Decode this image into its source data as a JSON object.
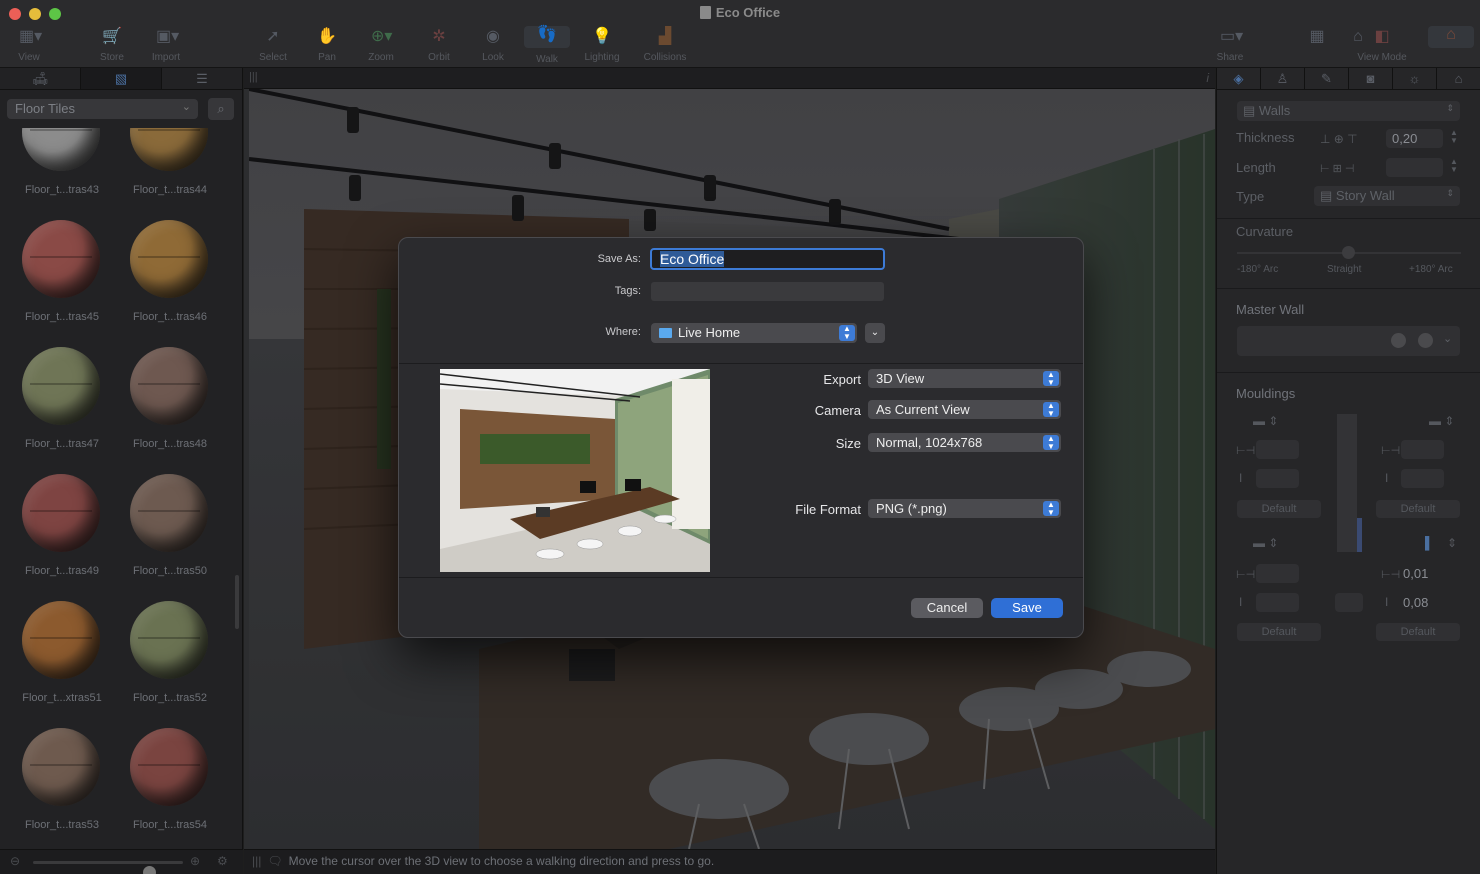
{
  "window": {
    "title": "Eco Office"
  },
  "toolbar": {
    "tools": [
      {
        "label": "View",
        "icon": "view-icon"
      },
      {
        "label": "Store",
        "icon": "cart-icon"
      },
      {
        "label": "Import",
        "icon": "import-icon"
      },
      {
        "label": "Select",
        "icon": "cursor-icon"
      },
      {
        "label": "Pan",
        "icon": "hand-icon"
      },
      {
        "label": "Zoom",
        "icon": "zoom-icon"
      },
      {
        "label": "Orbit",
        "icon": "orbit-icon"
      },
      {
        "label": "Look",
        "icon": "eye-icon"
      },
      {
        "label": "Walk",
        "icon": "walk-icon"
      },
      {
        "label": "Lighting",
        "icon": "bulb-icon"
      },
      {
        "label": "Collisions",
        "icon": "collisions-icon"
      },
      {
        "label": "Share",
        "icon": "share-icon"
      },
      {
        "label": "View Mode",
        "icon": "view-mode-icon"
      }
    ]
  },
  "library": {
    "category": "Floor Tiles",
    "items": [
      {
        "name": "Floor_t...tras43",
        "color": "#8c8c8c"
      },
      {
        "name": "Floor_t...tras44",
        "color": "#8a6a3a"
      },
      {
        "name": "Floor_t...tras45",
        "color": "#8a4a46"
      },
      {
        "name": "Floor_t...tras46",
        "color": "#8f6a36"
      },
      {
        "name": "Floor_t...tras47",
        "color": "#6f7556"
      },
      {
        "name": "Floor_t...tras48",
        "color": "#6e5850"
      },
      {
        "name": "Floor_t...tras49",
        "color": "#7e4442"
      },
      {
        "name": "Floor_t...tras50",
        "color": "#6d5a50"
      },
      {
        "name": "Floor_t...xtras51",
        "color": "#8c5a2e"
      },
      {
        "name": "Floor_t...tras52",
        "color": "#6a7252"
      },
      {
        "name": "Floor_t...tras53",
        "color": "#6e5a4e"
      },
      {
        "name": "Floor_t...tras54",
        "color": "#7a4440"
      }
    ]
  },
  "status": {
    "message": "Move the cursor over the 3D view to choose a walking direction and press to go."
  },
  "inspector": {
    "object_type": "Walls",
    "thickness_label": "Thickness",
    "thickness_value": "0,20",
    "length_label": "Length",
    "type_label": "Type",
    "type_value": "Story Wall",
    "curvature_label": "Curvature",
    "curvature_min": "-180° Arc",
    "curvature_mid": "Straight",
    "curvature_max": "+180° Arc",
    "master_wall_label": "Master Wall",
    "mouldings_label": "Mouldings",
    "default_label": "Default",
    "right_bottom_width": "0,01",
    "right_bottom_height": "0,08"
  },
  "dialog": {
    "save_as_label": "Save As:",
    "save_as_value": "Eco Office",
    "tags_label": "Tags:",
    "where_label": "Where:",
    "where_value": "Live Home",
    "export_label": "Export",
    "export_value": "3D View",
    "camera_label": "Camera",
    "camera_value": "As Current View",
    "size_label": "Size",
    "size_value": "Normal, 1024x768",
    "format_label": "File Format",
    "format_value": "PNG (*.png)",
    "cancel_label": "Cancel",
    "save_label": "Save"
  }
}
